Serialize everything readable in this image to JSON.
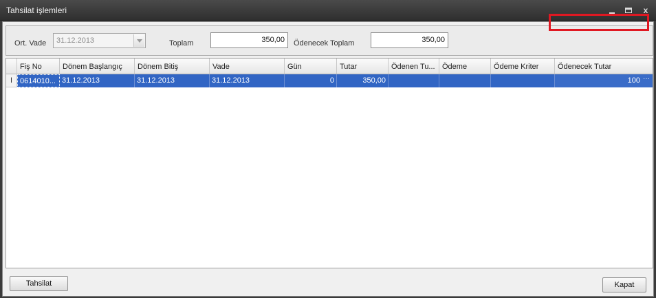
{
  "window": {
    "title": "Tahsilat işlemleri",
    "controls": {
      "minimize_icon": "minimize-icon",
      "maximize_icon": "maximize-icon",
      "close_icon": "close-icon",
      "close_glyph": "x"
    }
  },
  "filters": {
    "ort_vade_label": "Ort. Vade",
    "ort_vade_value": "31.12.2013",
    "toplam_label": "Toplam",
    "toplam_value": "350,00",
    "odenecek_toplam_label": "Ödenecek Toplam",
    "odenecek_toplam_value": "350,00"
  },
  "grid": {
    "columns": [
      "Fiş No",
      "Dönem Başlangıç",
      "Dönem Bitiş",
      "Vade",
      "Gün",
      "Tutar",
      "Ödenen Tu...",
      "Ödeme",
      "Ödeme Kriter",
      "Ödenecek Tutar"
    ],
    "rows": [
      {
        "indicator": "I",
        "fis_no": "0614010...",
        "donem_baslangic": "31.12.2013",
        "donem_bitis": "31.12.2013",
        "vade": "31.12.2013",
        "gun": "0",
        "tutar": "350,00",
        "odenen_tutar": "",
        "odeme": "",
        "odeme_kriter": "",
        "odenecek_tutar": "100",
        "ellipsis": "···"
      }
    ]
  },
  "buttons": {
    "tahsilat": "Tahsilat",
    "kapat": "Kapat"
  }
}
